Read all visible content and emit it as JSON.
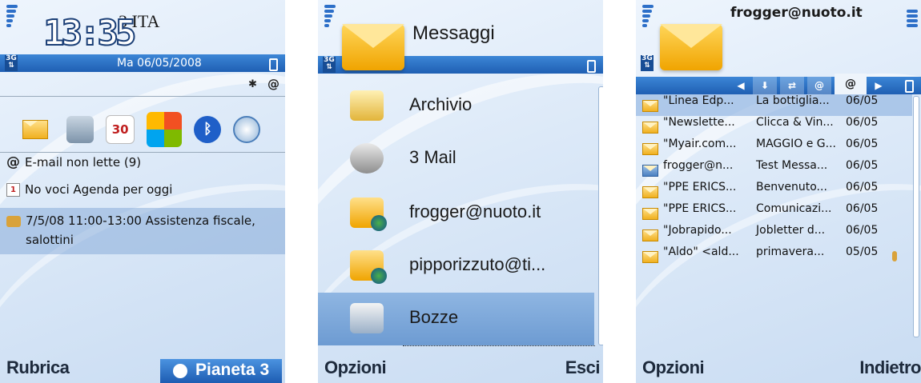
{
  "screen1": {
    "clock": "13:35",
    "operator": "3 ITA",
    "date": "Ma 06/05/2008",
    "status_icons": [
      "bluetooth-icon",
      "at-icon"
    ],
    "shortcut_icons": [
      "envelope-icon",
      "camera-icon",
      "calendar-icon",
      "windows-icon",
      "bluetooth-icon",
      "clock-icon"
    ],
    "notifications": [
      {
        "icon": "at-icon",
        "text": "E-mail non lette (9)"
      },
      {
        "icon": "calendar-small-icon",
        "text": "No voci Agenda per oggi"
      },
      {
        "icon": "handshake-icon",
        "text": "7/5/08 11:00-13:00 Assistenza fiscale,",
        "text2": "salottini"
      }
    ],
    "softkey_left": "Rubrica",
    "softkey_right": "Pianeta 3"
  },
  "screen2": {
    "title": "Messaggi",
    "items": [
      {
        "icon": "folder-icon",
        "label": "Archivio"
      },
      {
        "icon": "mailbox-icon",
        "label": "3 Mail"
      },
      {
        "icon": "globe-mail-icon",
        "label": "frogger@nuoto.it"
      },
      {
        "icon": "globe-mail-icon",
        "label": "pipporizzuto@ti..."
      },
      {
        "icon": "drafts-icon",
        "label": "Bozze"
      }
    ],
    "selected_index": 4,
    "softkey_left": "Opzioni",
    "softkey_right": "Esci"
  },
  "screen3": {
    "title": "frogger@nuoto.it",
    "tabs": [
      "at-icon"
    ],
    "messages": [
      {
        "from": "\"Linea Edp...",
        "subject": "La bottiglia...",
        "date": "06/05"
      },
      {
        "from": "\"Newslette...",
        "subject": "Clicca & Vin...",
        "date": "06/05"
      },
      {
        "from": "\"Myair.com...",
        "subject": "MAGGIO e G...",
        "date": "06/05"
      },
      {
        "from": "frogger@n...",
        "subject": "Test Messa...",
        "date": "06/05"
      },
      {
        "from": "\"PPE ERICS...",
        "subject": "Benvenuto...",
        "date": "06/05"
      },
      {
        "from": "\"PPE ERICS...",
        "subject": "Comunicazi...",
        "date": "06/05"
      },
      {
        "from": "\"Jobrapido...",
        "subject": "Jobletter d...",
        "date": "06/05"
      },
      {
        "from": "\"Aldo\" <ald...",
        "subject": "primavera...",
        "date": "05/05"
      }
    ],
    "softkey_left": "Opzioni",
    "softkey_right": "Indietro"
  },
  "colors": {
    "accent": "#2a6fc4",
    "highlight": "#8fb6e2"
  }
}
